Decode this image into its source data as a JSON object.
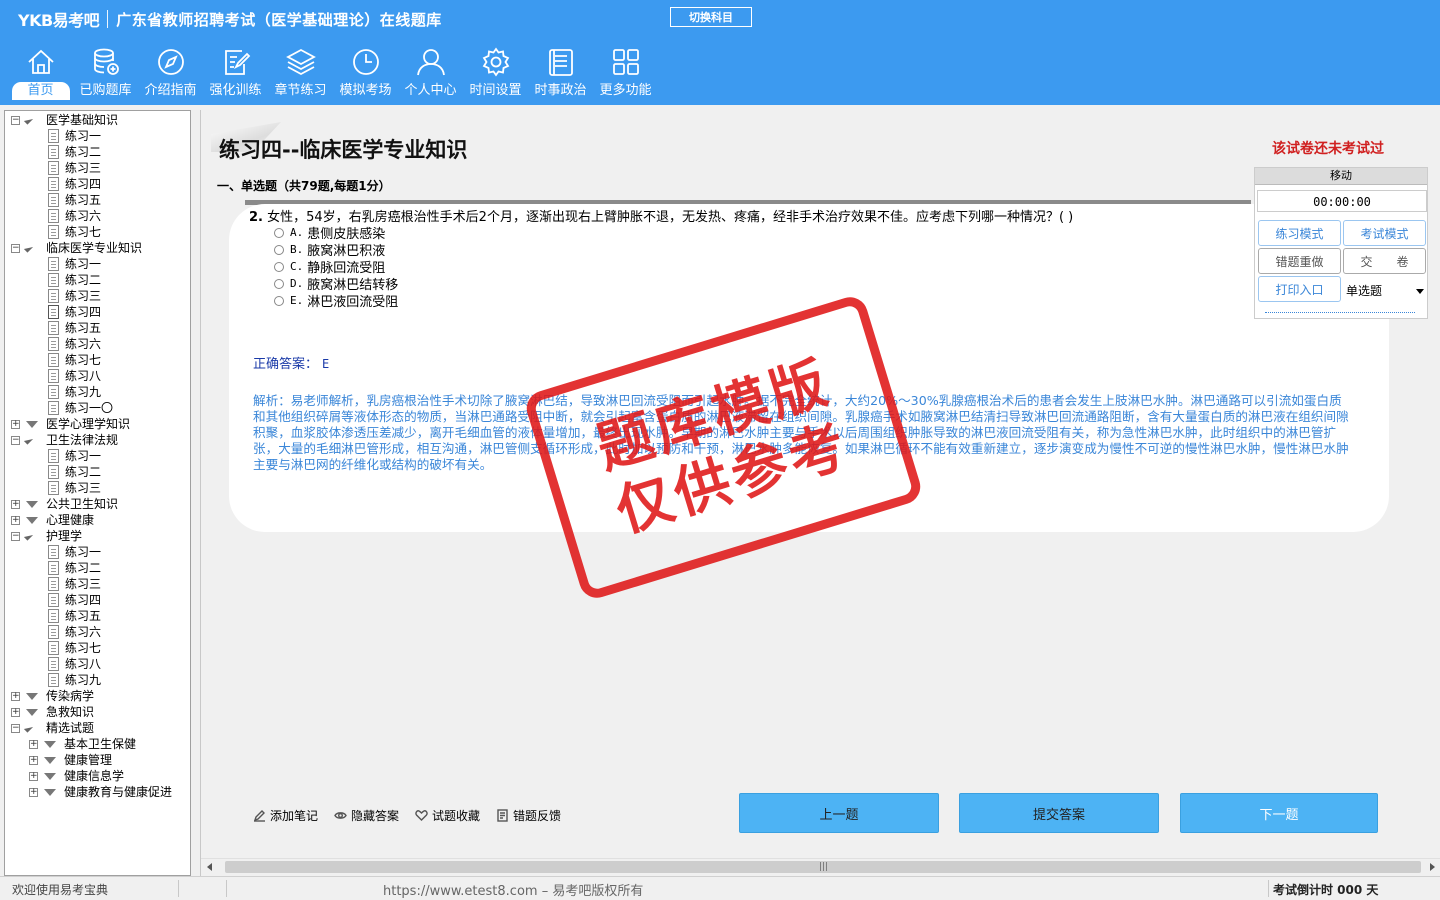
{
  "header": {
    "logo": "YKB易考吧",
    "title": "广东省教师招聘考试（医学基础理论）在线题库",
    "switch_subject": "切换科目",
    "nav": [
      {
        "label": "首页",
        "icon": "home-icon"
      },
      {
        "label": "已购题库",
        "icon": "database-icon"
      },
      {
        "label": "介绍指南",
        "icon": "compass-icon"
      },
      {
        "label": "强化训练",
        "icon": "edit-icon"
      },
      {
        "label": "章节练习",
        "icon": "layers-icon"
      },
      {
        "label": "模拟考场",
        "icon": "clock-icon"
      },
      {
        "label": "个人中心",
        "icon": "user-icon"
      },
      {
        "label": "时间设置",
        "icon": "gear-icon"
      },
      {
        "label": "时事政治",
        "icon": "news-icon"
      },
      {
        "label": "更多功能",
        "icon": "grid-icon"
      }
    ]
  },
  "tree": [
    {
      "label": "医学基础知识",
      "level": 0,
      "open": true
    },
    {
      "label": "练习一",
      "level": 1
    },
    {
      "label": "练习二",
      "level": 1
    },
    {
      "label": "练习三",
      "level": 1
    },
    {
      "label": "练习四",
      "level": 1
    },
    {
      "label": "练习五",
      "level": 1
    },
    {
      "label": "练习六",
      "level": 1
    },
    {
      "label": "练习七",
      "level": 1
    },
    {
      "label": "临床医学专业知识",
      "level": 0,
      "open": true
    },
    {
      "label": "练习一",
      "level": 1
    },
    {
      "label": "练习二",
      "level": 1
    },
    {
      "label": "练习三",
      "level": 1
    },
    {
      "label": "练习四",
      "level": 1,
      "selected": true
    },
    {
      "label": "练习五",
      "level": 1
    },
    {
      "label": "练习六",
      "level": 1
    },
    {
      "label": "练习七",
      "level": 1
    },
    {
      "label": "练习八",
      "level": 1
    },
    {
      "label": "练习九",
      "level": 1
    },
    {
      "label": "练习一〇",
      "level": 1
    },
    {
      "label": "医学心理学知识",
      "level": 0,
      "open": false
    },
    {
      "label": "卫生法律法规",
      "level": 0,
      "open": true
    },
    {
      "label": "练习一",
      "level": 1
    },
    {
      "label": "练习二",
      "level": 1
    },
    {
      "label": "练习三",
      "level": 1
    },
    {
      "label": "公共卫生知识",
      "level": 0,
      "open": false
    },
    {
      "label": "心理健康",
      "level": 0,
      "open": false
    },
    {
      "label": "护理学",
      "level": 0,
      "open": true
    },
    {
      "label": "练习一",
      "level": 1
    },
    {
      "label": "练习二",
      "level": 1
    },
    {
      "label": "练习三",
      "level": 1
    },
    {
      "label": "练习四",
      "level": 1
    },
    {
      "label": "练习五",
      "level": 1
    },
    {
      "label": "练习六",
      "level": 1
    },
    {
      "label": "练习七",
      "level": 1
    },
    {
      "label": "练习八",
      "level": 1
    },
    {
      "label": "练习九",
      "level": 1
    },
    {
      "label": "传染病学",
      "level": 0,
      "open": false
    },
    {
      "label": "急救知识",
      "level": 0,
      "open": false
    },
    {
      "label": "精选试题",
      "level": 0,
      "open": true
    },
    {
      "label": "基本卫生保健",
      "level": 1,
      "folder": true
    },
    {
      "label": "健康管理",
      "level": 1,
      "folder": true
    },
    {
      "label": "健康信息学",
      "level": 1,
      "folder": true
    },
    {
      "label": "健康教育与健康促进",
      "level": 1,
      "folder": true
    }
  ],
  "exam": {
    "title": "练习四--临床医学专业知识",
    "status": "该试卷还未考试过",
    "section": "一、单选题（共79题,每题1分）",
    "question_number": "2.",
    "question_text": "女性，54岁，右乳房癌根治性手术后2个月，逐渐出现右上臂肿胀不退，无发热、疼痛，经非手术治疗效果不佳。应考虑下列哪一种情况？( )",
    "options": [
      {
        "letter": "A.",
        "text": "患侧皮肤感染"
      },
      {
        "letter": "B.",
        "text": "腋窝淋巴积液"
      },
      {
        "letter": "C.",
        "text": "静脉回流受阻"
      },
      {
        "letter": "D.",
        "text": "腋窝淋巴结转移"
      },
      {
        "letter": "E.",
        "text": "淋巴液回流受阻"
      }
    ],
    "answer_label": "正确答案：",
    "answer_value": "E",
    "analysis": "解析：易老师解析，乳房癌根治性手术切除了腋窝淋巴结，导致淋巴回流受阻而引起水肿。据不完全统计，大约20%～30%乳腺癌根治术后的患者会发生上肢淋巴水肿。淋巴通路可以引流如蛋白质和其他组织碎屑等液体形态的物质，当淋巴通路受阻中断，就会引起富含蛋白质的淋巴液滞留在组织间隙。乳腺癌手术如腋窝淋巴结清扫导致淋巴回流通路阻断，含有大量蛋白质的淋巴液在组织间隙积聚，血浆胶体渗透压差减少，离开毛细血管的液体量增加，最终出现水肿。早期的淋巴水肿主要与手术以后周围组织肿胀导致的淋巴液回流受阻有关，称为急性淋巴水肿，此时组织中的淋巴管扩张，大量的毛细淋巴管形成，相互沟通，淋巴管侧支循环形成，此时加以预防和干预，淋巴水肿多能恢复。如果淋巴循环不能有效重新建立，逐步演变成为慢性不可逆的慢性淋巴水肿，慢性淋巴水肿主要与淋巴网的纤维化或结构的破坏有关。",
    "watermark_line1": "题库模版",
    "watermark_line2": "仅供参考"
  },
  "panel": {
    "move": "移动",
    "timer": "00:00:00",
    "practice_mode": "练习模式",
    "exam_mode": "考试模式",
    "redo_wrong": "错题重做",
    "submit_paper": "交　　卷",
    "print": "打印入口",
    "type_select": "单选题"
  },
  "tools": {
    "add_note": "添加笔记",
    "hide_answer": "隐藏答案",
    "favorite": "试题收藏",
    "feedback": "错题反馈"
  },
  "buttons": {
    "prev": "上一题",
    "submit": "提交答案",
    "next": "下一题"
  },
  "status": {
    "welcome": "欢迎使用易考宝典",
    "copyright": "https://www.etest8.com – 易考吧版权所有",
    "countdown": "考试倒计时 000 天"
  },
  "colors": {
    "header_bg": "#3c9af0",
    "button_bg": "#4db3f4",
    "answer": "#1a3aa8",
    "analysis": "#3a86d8",
    "warning": "#d02020",
    "stamp": "#e01818"
  }
}
